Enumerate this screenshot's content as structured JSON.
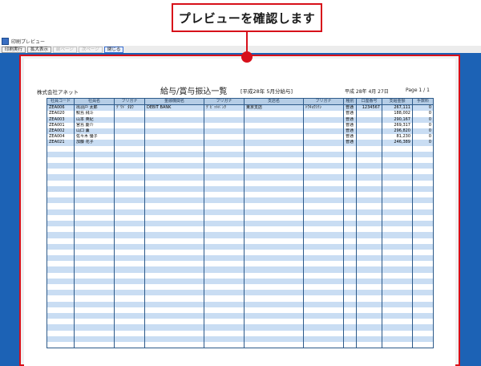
{
  "callout": {
    "text": "プレビューを確認します"
  },
  "window": {
    "title": "印刷プレビュー"
  },
  "toolbar": [
    {
      "label": "印刷実行",
      "state": "normal"
    },
    {
      "label": "拡大表示",
      "state": "normal"
    },
    {
      "label": "前ページ",
      "state": "disabled"
    },
    {
      "label": "次ページ",
      "state": "disabled"
    },
    {
      "label": "閉じる",
      "state": "active"
    }
  ],
  "report": {
    "company": "株式会社アネット",
    "title": "給与/賞与振込一覧",
    "subtitle": "[平成28年 5月分給与]",
    "date": "平成 28年 4月 27日",
    "page": "Page 1 / 1",
    "columns": [
      "社員コード",
      "社員名",
      "フリガナ",
      "金融機関名",
      "フリガナ",
      "支店名",
      "フリガナ",
      "種別",
      "口座番号",
      "支給金額",
      "手数料"
    ],
    "rows": [
      [
        "ZEA006",
        "出羽戸 太郎",
        "ﾃﾞﾜﾄﾞ ﾀﾛｳ",
        "DEBIT BANK",
        "ﾃﾞﾋﾞｯﾄﾊﾞﾝｸ",
        "東京支店",
        "ﾄｳｷｮｳｼﾃﾝ",
        "普通",
        "1234567",
        "267,111",
        "0"
      ],
      [
        "ZEA020",
        "鮫島 飛斗",
        "",
        "",
        "",
        "",
        "",
        "普通",
        "",
        "188,002",
        "0"
      ],
      [
        "ZEA003",
        "山本 英紀",
        "",
        "",
        "",
        "",
        "",
        "普通",
        "",
        "290,167",
        "0"
      ],
      [
        "ZEA001",
        "宮島 慶介",
        "",
        "",
        "",
        "",
        "",
        "普通",
        "",
        "269,317",
        "0"
      ],
      [
        "ZEA002",
        "山口 薫",
        "",
        "",
        "",
        "",
        "",
        "普通",
        "",
        "296,820",
        "0"
      ],
      [
        "ZEA004",
        "佐々木 優子",
        "",
        "",
        "",
        "",
        "",
        "普通",
        "",
        "81,230",
        "0"
      ],
      [
        "ZEA021",
        "加藤 花子",
        "",
        "",
        "",
        "",
        "",
        "普通",
        "",
        "246,389",
        "0"
      ]
    ]
  }
}
